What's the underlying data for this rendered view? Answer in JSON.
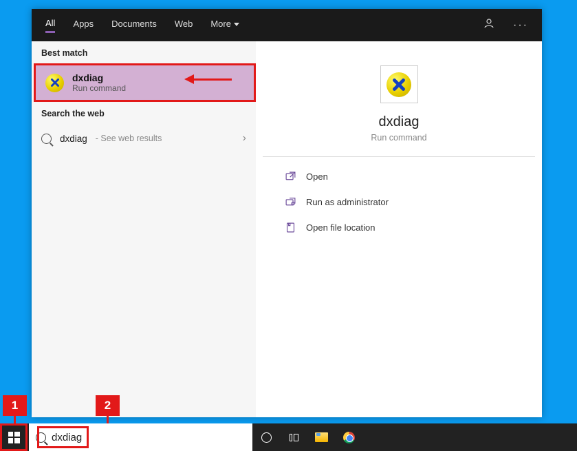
{
  "tabs": {
    "all": "All",
    "apps": "Apps",
    "documents": "Documents",
    "web": "Web",
    "more": "More"
  },
  "left": {
    "bestMatchLabel": "Best match",
    "match": {
      "title": "dxdiag",
      "sub": "Run command"
    },
    "searchWebLabel": "Search the web",
    "webResult": {
      "term": "dxdiag",
      "sub": "- See web results"
    }
  },
  "preview": {
    "title": "dxdiag",
    "sub": "Run command",
    "actions": {
      "open": "Open",
      "admin": "Run as administrator",
      "location": "Open file location"
    }
  },
  "search": {
    "value": "dxdiag"
  },
  "callouts": {
    "one": "1",
    "two": "2"
  }
}
